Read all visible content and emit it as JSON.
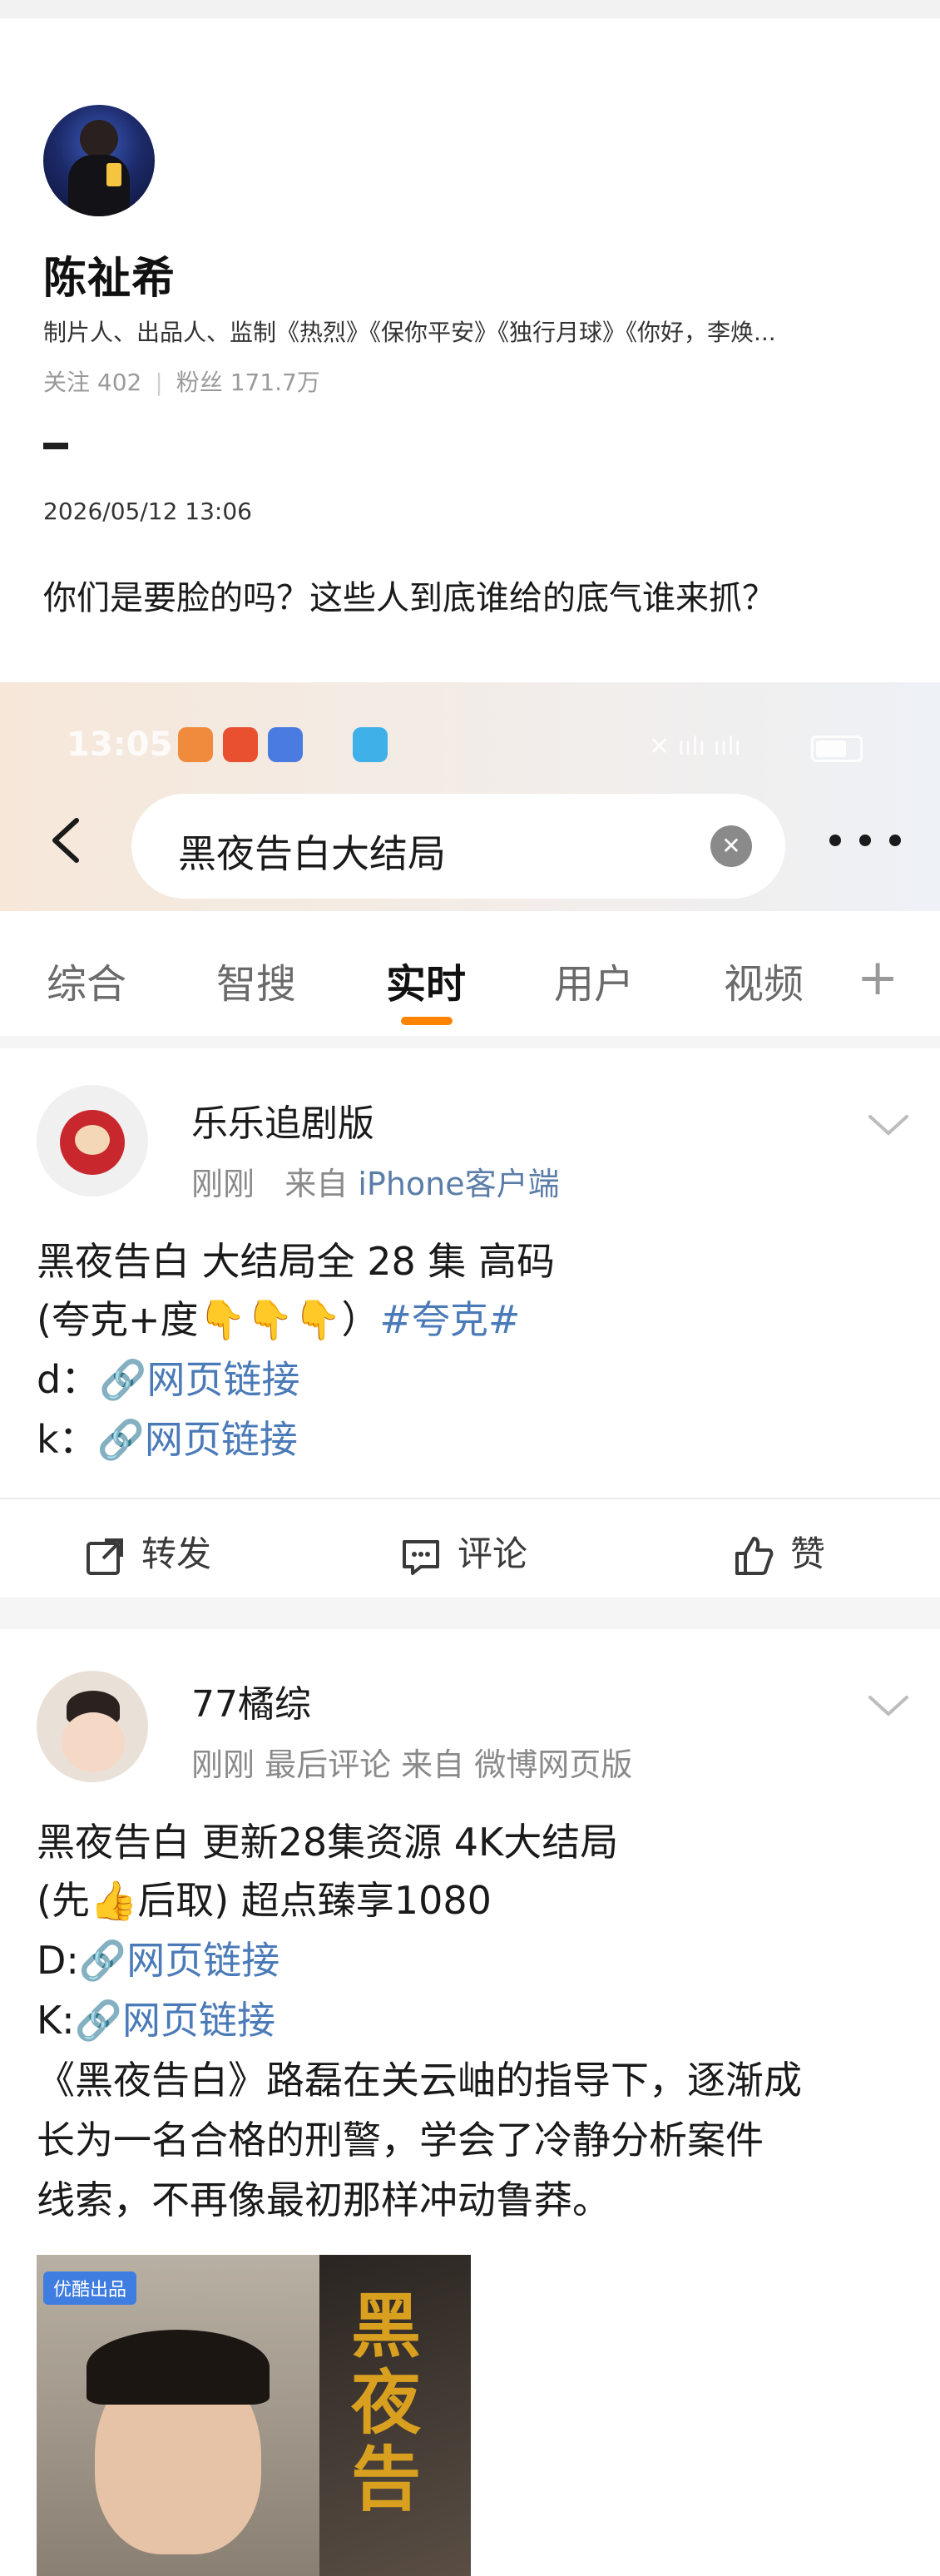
{
  "post": {
    "author": "陈祉希",
    "bio": "制片人、出品人、监制《热烈》《保你平安》《独行月球》《你好，李焕...",
    "follow": "关注 402",
    "fans": "粉丝 171.7万",
    "date": "2026/05/12 13:06",
    "text": "你们是要脸的吗？这些人到底谁给的底气谁来抓？"
  },
  "screenshot": {
    "status_time": "13:05",
    "search_query": "黑夜告白大结局",
    "tabs": [
      "综合",
      "智搜",
      "实时",
      "用户",
      "视频"
    ],
    "active_tab": "实时",
    "cards": [
      {
        "user": "乐乐追剧版",
        "meta_time": "刚刚",
        "meta_from": "来自",
        "meta_source": "iPhone客户端",
        "line1": "黑夜告白 大结局全 28 集 高码",
        "line2_pre": "(夸克+度",
        "line2_emoji": "👇👇👇",
        "line2_mid": "）",
        "line2_tag": "#夸克#",
        "line3_label": "d：",
        "line4_label": "k：",
        "link_text": "网页链接",
        "actions": {
          "repost": "转发",
          "comment": "评论",
          "like": "赞"
        }
      },
      {
        "user": "77橘综",
        "meta": "刚刚 最后评论  来自 微博网页版",
        "line1": "黑夜告白  更新28集资源 4K大结局",
        "line2_pre": "(先",
        "line2_emoji": "👍",
        "line2_post": "后取) 超点臻享1080",
        "line3_label": "D:",
        "line4_label": "K:",
        "link_text": "网页链接",
        "body1": "《黑夜告白》路磊在关云岫的指导下，逐渐成",
        "body2": "长为一名合格的刑警，学会了冷静分析案件",
        "body3": "线索，不再像最初那样冲动鲁莽。",
        "poster_badge": "优酷出品",
        "poster_title": "黑夜告"
      }
    ]
  }
}
